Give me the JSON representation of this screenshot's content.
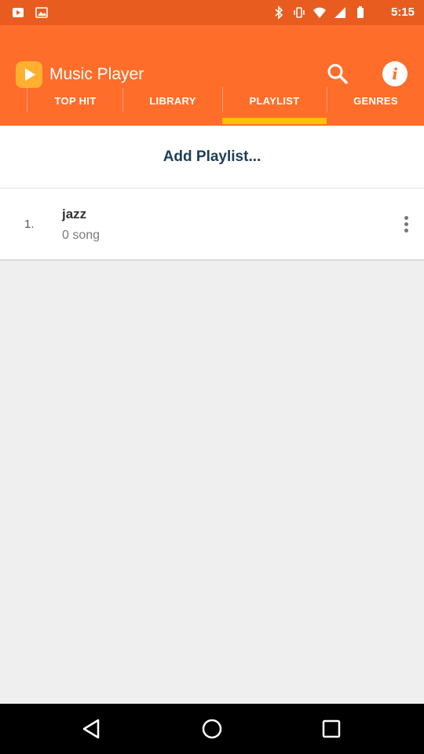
{
  "status_bar": {
    "time": "5:15",
    "icons": [
      "bluetooth-icon",
      "vibrate-icon",
      "wifi-icon",
      "signal-icon",
      "battery-icon"
    ]
  },
  "app_bar": {
    "title": "Music Player",
    "logo_icon": "play-logo-icon",
    "actions": [
      "search-icon",
      "info-icon"
    ]
  },
  "tabs": [
    {
      "label": "",
      "active": false
    },
    {
      "label": "TOP HIT",
      "active": false
    },
    {
      "label": "LIBRARY",
      "active": false
    },
    {
      "label": "PLAYLIST",
      "active": true
    },
    {
      "label": "GENRES",
      "active": false
    }
  ],
  "playlist": {
    "add_label": "Add Playlist...",
    "items": [
      {
        "number": "1.",
        "title": "jazz",
        "subtitle": "0 song"
      }
    ]
  },
  "nav_bar": {
    "buttons": [
      "back-icon",
      "home-icon",
      "recents-icon"
    ]
  },
  "colors": {
    "app_bar": "#ff6d2a",
    "status_bar": "#e85d1f",
    "tab_indicator": "#ffc300",
    "add_label": "#1d3e54"
  }
}
